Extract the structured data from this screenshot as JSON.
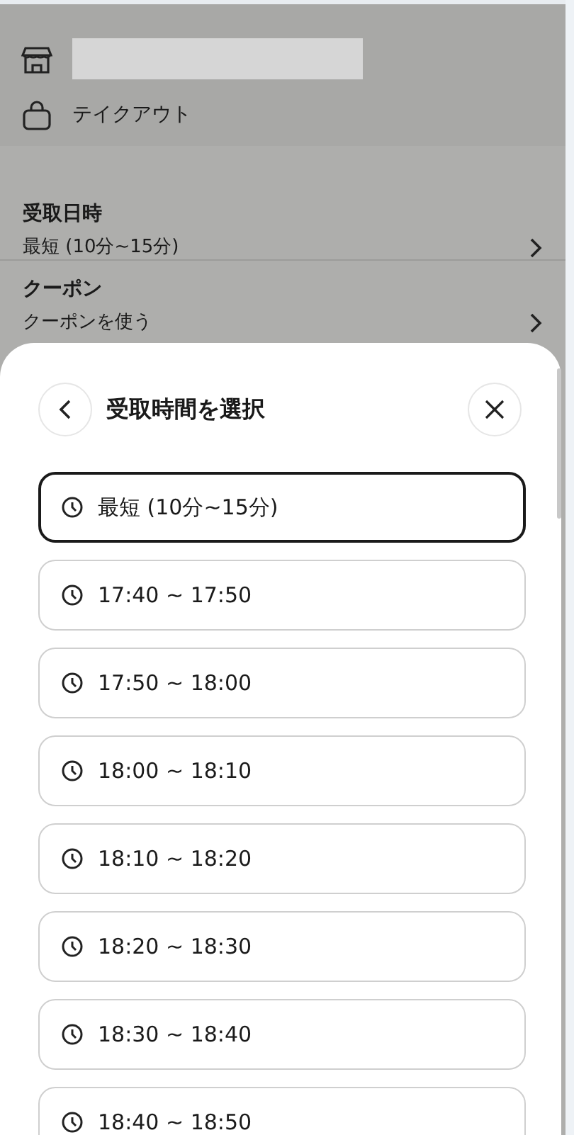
{
  "store": {
    "mode": "テイクアウト"
  },
  "rows": [
    {
      "title": "受取日時",
      "value": "最短 (10分~15分)"
    },
    {
      "title": "クーポン",
      "value": "クーポンを使う"
    }
  ],
  "sheet": {
    "title": "受取時間を選択",
    "options": [
      {
        "label": "最短 (10分~15分)",
        "selected": true
      },
      {
        "label": "17:40 ~ 17:50",
        "selected": false
      },
      {
        "label": "17:50 ~ 18:00",
        "selected": false
      },
      {
        "label": "18:00 ~ 18:10",
        "selected": false
      },
      {
        "label": "18:10 ~ 18:20",
        "selected": false
      },
      {
        "label": "18:20 ~ 18:30",
        "selected": false
      },
      {
        "label": "18:30 ~ 18:40",
        "selected": false
      },
      {
        "label": "18:40 ~ 18:50",
        "selected": false
      }
    ]
  }
}
